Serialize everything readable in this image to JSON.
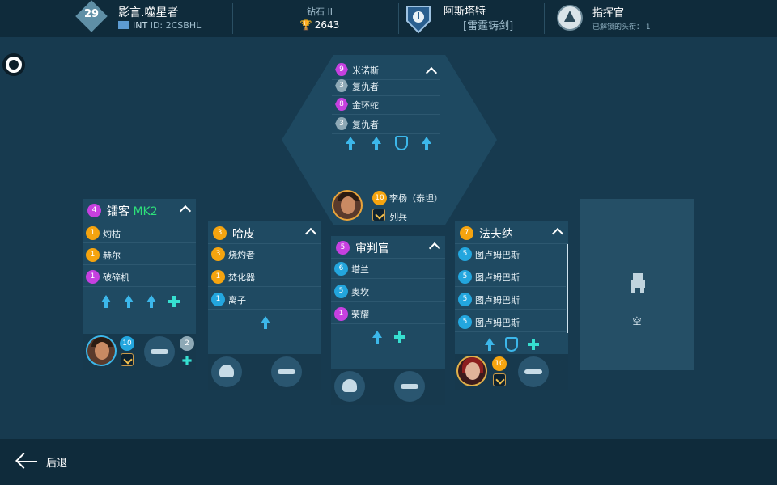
{
  "header": {
    "player": {
      "level": "29",
      "name": "影言.噬星者",
      "region": "INT",
      "id_label": "ID: 2CSBHL"
    },
    "league": {
      "name": "钻石 II",
      "score": "2643"
    },
    "clan": {
      "name": "阿斯塔特",
      "tag": "[雷霆铸剑]"
    },
    "commander": {
      "title": "指挥官",
      "unlocked_label": "已解锁的头衔：",
      "unlocked_count": "1"
    }
  },
  "titan": {
    "modules": [
      {
        "level": "9",
        "name": "米诺斯",
        "color": "purple"
      },
      {
        "level": "3",
        "name": "复仇者",
        "color": "grey"
      },
      {
        "level": "8",
        "name": "金环蛇",
        "color": "purple"
      },
      {
        "level": "3",
        "name": "复仇者",
        "color": "grey"
      }
    ],
    "pilot": {
      "level": "10",
      "name": "李杨（泰坦）",
      "rank": "列兵"
    }
  },
  "robots": [
    {
      "level": "4",
      "name": "镭客",
      "suffix": "MK2",
      "weapons": [
        {
          "level": "1",
          "name": "灼枯",
          "color": "orange"
        },
        {
          "level": "1",
          "name": "赫尔",
          "color": "orange"
        },
        {
          "level": "1",
          "name": "破碎机",
          "color": "purple"
        }
      ],
      "pilot_level": "10",
      "drone_level": "2"
    },
    {
      "level": "3",
      "name": "哈皮",
      "weapons": [
        {
          "level": "3",
          "name": "烧灼者",
          "color": "orange"
        },
        {
          "level": "1",
          "name": "焚化器",
          "color": "orange"
        },
        {
          "level": "1",
          "name": "离子",
          "color": "blue"
        }
      ]
    },
    {
      "level": "5",
      "name": "审判官",
      "weapons": [
        {
          "level": "6",
          "name": "塔兰",
          "color": "blue"
        },
        {
          "level": "5",
          "name": "奥坎",
          "color": "blue"
        },
        {
          "level": "1",
          "name": "荣耀",
          "color": "purple"
        }
      ]
    },
    {
      "level": "7",
      "name": "法夫纳",
      "weapons": [
        {
          "level": "5",
          "name": "图卢姆巴斯",
          "color": "blue"
        },
        {
          "level": "5",
          "name": "图卢姆巴斯",
          "color": "blue"
        },
        {
          "level": "5",
          "name": "图卢姆巴斯",
          "color": "blue"
        },
        {
          "level": "5",
          "name": "图卢姆巴斯",
          "color": "blue"
        }
      ],
      "pilot_level": "10"
    }
  ],
  "empty_slot": {
    "label": "空"
  },
  "footer": {
    "back_label": "后退"
  },
  "colors": {
    "orange": "#f5a40f",
    "purple": "#c640e0",
    "blue": "#23a6de",
    "grey": "#8ea9b6",
    "mk_green": "#2ee07a"
  }
}
